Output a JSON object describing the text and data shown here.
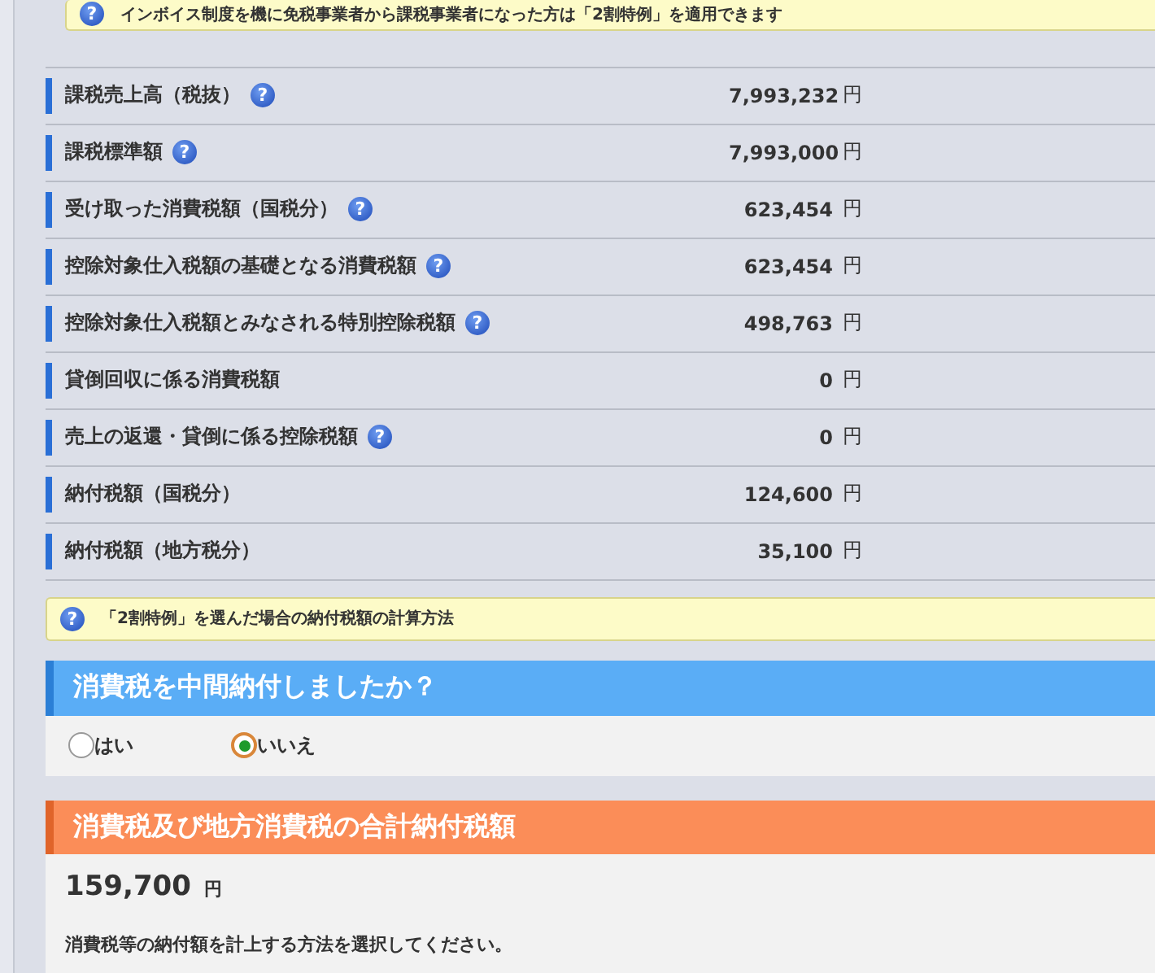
{
  "help_glyph": "?",
  "top_note": {
    "text": "インボイス制度を機に免税事業者から課税事業者になった方は「2割特例」を適用できます",
    "help": true
  },
  "rows": [
    {
      "label": "課税売上高（税抜）",
      "help": true,
      "value": "7,993,232",
      "unit": "円"
    },
    {
      "label": "課税標準額",
      "help": true,
      "value": "7,993,000",
      "unit": "円"
    },
    {
      "label": "受け取った消費税額（国税分）",
      "help": true,
      "value": "623,454",
      "unit": "円"
    },
    {
      "label": "控除対象仕入税額の基礎となる消費税額",
      "help": true,
      "value": "623,454",
      "unit": "円"
    },
    {
      "label": "控除対象仕入税額とみなされる特別控除税額",
      "help": true,
      "value": "498,763",
      "unit": "円"
    },
    {
      "label": "貸倒回収に係る消費税額",
      "help": false,
      "value": "0",
      "unit": "円"
    },
    {
      "label": "売上の返還・貸倒に係る控除税額",
      "help": true,
      "value": "0",
      "unit": "円"
    },
    {
      "label": "納付税額（国税分）",
      "help": false,
      "value": "124,600",
      "unit": "円"
    },
    {
      "label": "納付税額（地方税分）",
      "help": false,
      "value": "35,100",
      "unit": "円"
    }
  ],
  "calc_note": {
    "text": "「2割特例」を選んだ場合の納付税額の計算方法",
    "help": true
  },
  "interim": {
    "title": "消費税を中間納付しましたか？",
    "options": [
      {
        "label": "はい",
        "selected": false
      },
      {
        "label": "いいえ",
        "selected": true
      }
    ]
  },
  "total": {
    "title": "消費税及び地方消費税の合計納付税額",
    "value": "159,700",
    "unit": "円",
    "instruction": "消費税等の納付額を計上する方法を選択してください。"
  }
}
